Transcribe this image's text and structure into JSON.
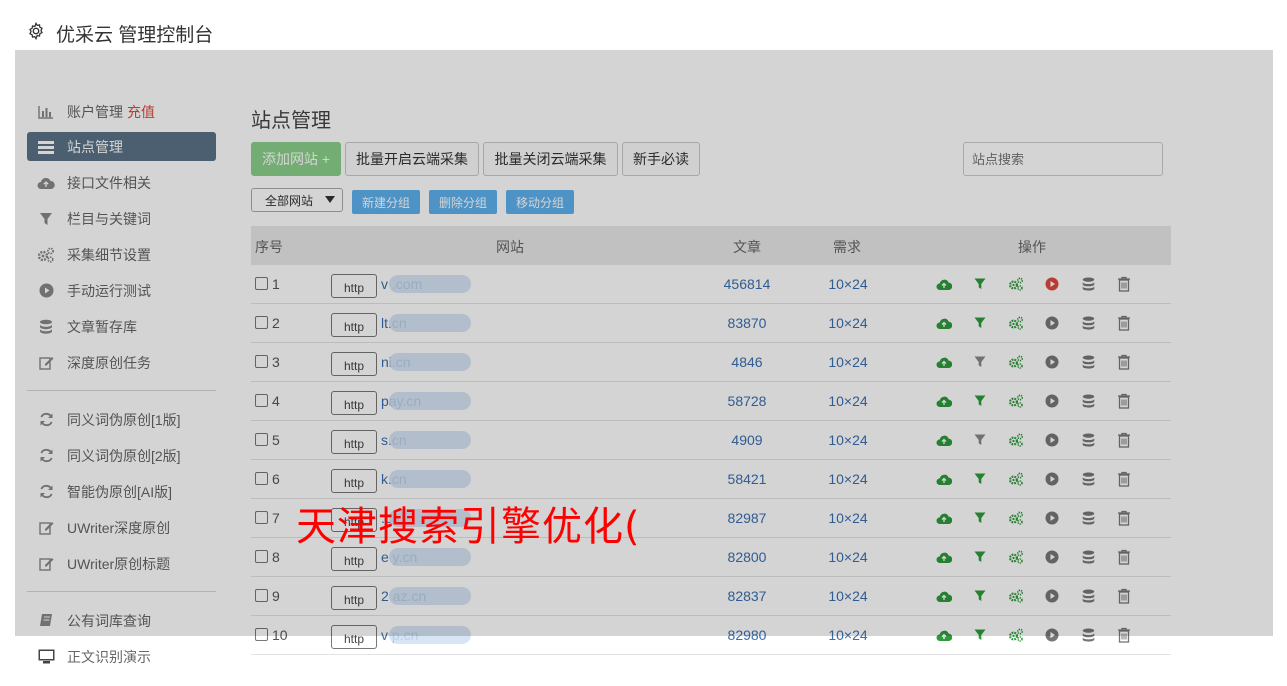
{
  "header": {
    "title": "优采云 管理控制台",
    "icon": "gear-icon"
  },
  "sidebar": {
    "items": [
      {
        "label": "账户管理",
        "icon": "bar-chart-icon",
        "extra": "充值"
      },
      {
        "label": "站点管理",
        "icon": "list-icon",
        "active": true
      },
      {
        "label": "接口文件相关",
        "icon": "cloud-upload-icon"
      },
      {
        "label": "栏目与关键词",
        "icon": "filter-icon"
      },
      {
        "label": "采集细节设置",
        "icon": "cogs-icon"
      },
      {
        "label": "手动运行测试",
        "icon": "play-circle-icon"
      },
      {
        "label": "文章暂存库",
        "icon": "database-icon"
      },
      {
        "label": "深度原创任务",
        "icon": "edit-icon"
      },
      {
        "label": "同义词伪原创[1版]",
        "icon": "refresh-icon"
      },
      {
        "label": "同义词伪原创[2版]",
        "icon": "refresh-icon"
      },
      {
        "label": "智能伪原创[AI版]",
        "icon": "refresh-icon"
      },
      {
        "label": "UWriter深度原创",
        "icon": "edit-icon"
      },
      {
        "label": "UWriter原创标题",
        "icon": "edit-icon"
      },
      {
        "label": "公有词库查询",
        "icon": "book-icon"
      },
      {
        "label": "正文识别演示",
        "icon": "monitor-icon"
      }
    ]
  },
  "main": {
    "title": "站点管理",
    "toolbar": {
      "add_site": "添加网站 +",
      "batch_enable": "批量开启云端采集",
      "batch_disable": "批量关闭云端采集",
      "guide": "新手必读",
      "search_placeholder": "站点搜索"
    },
    "group_bar": {
      "select_value": "全部网站",
      "new_group": "新建分组",
      "delete_group": "删除分组",
      "move_group": "移动分组"
    },
    "table": {
      "headers": {
        "index": "序号",
        "site": "网站",
        "articles": "文章",
        "demand": "需求",
        "actions": "操作"
      },
      "http_label": "http",
      "rows": [
        {
          "num": "1",
          "site": "v .com",
          "articles": "456814",
          "demand": "10×24",
          "filter_active": true,
          "play_active": true
        },
        {
          "num": "2",
          "site": "lt.cn",
          "articles": "83870",
          "demand": "10×24",
          "filter_active": true,
          "play_active": false
        },
        {
          "num": "3",
          "site": "ni.cn",
          "articles": "4846",
          "demand": "10×24",
          "filter_active": false,
          "play_active": false
        },
        {
          "num": "4",
          "site": "pay.cn",
          "articles": "58728",
          "demand": "10×24",
          "filter_active": true,
          "play_active": false
        },
        {
          "num": "5",
          "site": "s.cn",
          "articles": "4909",
          "demand": "10×24",
          "filter_active": false,
          "play_active": false
        },
        {
          "num": "6",
          "site": "k.cn",
          "articles": "58421",
          "demand": "10×24",
          "filter_active": true,
          "play_active": false
        },
        {
          "num": "7",
          "site": ".cn",
          "articles": "82987",
          "demand": "10×24",
          "filter_active": true,
          "play_active": false
        },
        {
          "num": "8",
          "site": "e y.cn",
          "articles": "82800",
          "demand": "10×24",
          "filter_active": true,
          "play_active": false
        },
        {
          "num": "9",
          "site": "2 az.cn",
          "articles": "82837",
          "demand": "10×24",
          "filter_active": true,
          "play_active": false
        },
        {
          "num": "10",
          "site": "v p.cn",
          "articles": "82980",
          "demand": "10×24",
          "filter_active": true,
          "play_active": false
        }
      ]
    }
  },
  "watermark": "天津搜索引擎优化(",
  "colors": {
    "accent_green": "#2e9a3c",
    "play_red": "#e0483d",
    "link_blue": "#3a6fb0",
    "active_nav": "#5b7387"
  }
}
